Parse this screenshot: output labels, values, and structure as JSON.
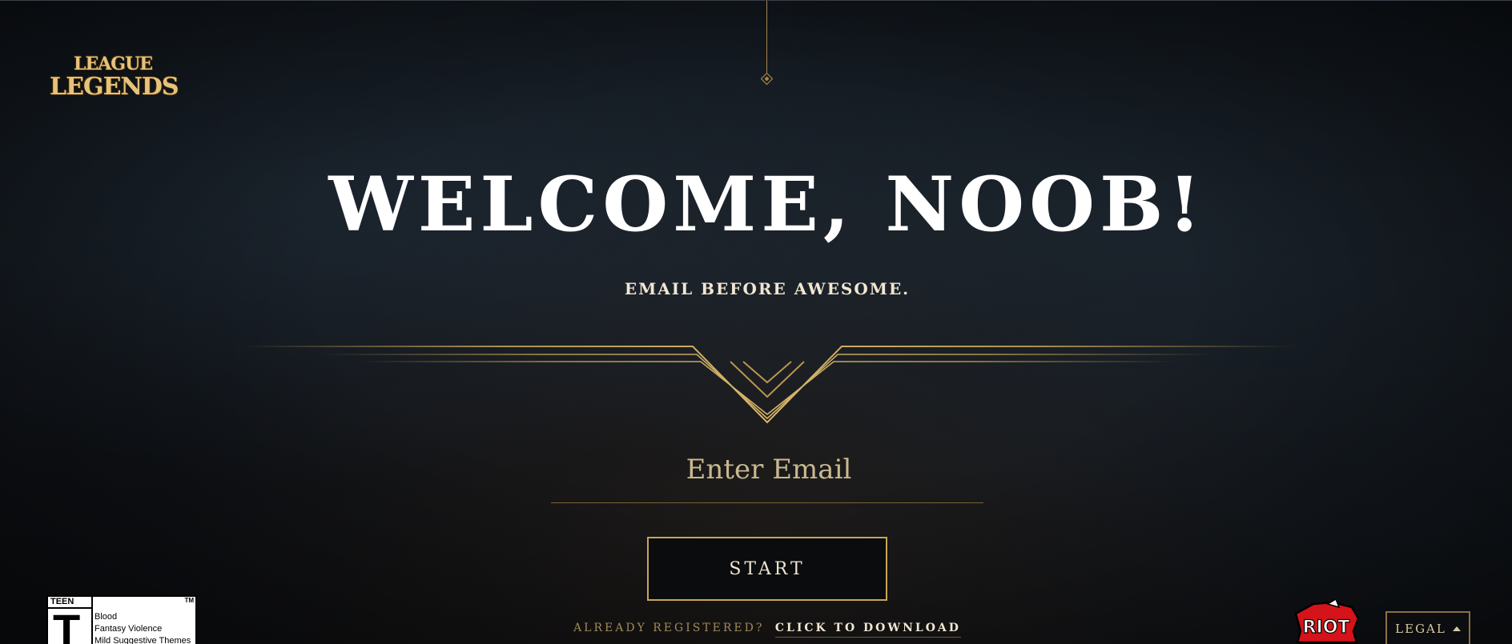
{
  "brand": {
    "logo_line1": "LEAGUE",
    "logo_line2": "LEGENDS",
    "accent_color": "#c8a659"
  },
  "hero": {
    "title": "WELCOME, NOOB!",
    "subtitle": "EMAIL BEFORE AWESOME."
  },
  "form": {
    "email_placeholder": "Enter Email",
    "email_value": "",
    "start_label": "START"
  },
  "footer": {
    "already_registered": "ALREADY REGISTERED?",
    "download_link": "CLICK TO DOWNLOAD",
    "legal_label": "LEGAL",
    "legal_icon": "caret-up-icon",
    "riot_logo_text": "RIOT"
  },
  "esrb": {
    "rating": "TEEN",
    "letter": "T",
    "trademark": "TM",
    "descriptors": [
      "Blood",
      "Fantasy Violence",
      "Mild Suggestive Themes"
    ]
  }
}
